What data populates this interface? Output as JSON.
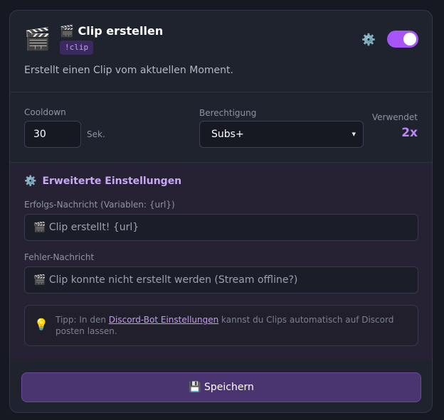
{
  "command": {
    "icon": "🎬",
    "icon_name": "clapperboard-icon",
    "title": "🎬 Clip erstellen",
    "trigger": "!clip",
    "description": "Erstellt einen Clip vom aktuellen Moment.",
    "enabled": true,
    "settings_icon": "⚙️"
  },
  "settings": {
    "cooldown_label": "Cooldown",
    "cooldown_value": "30",
    "cooldown_unit": "Sek.",
    "permission_label": "Berechtigung",
    "permission_value": "Subs+",
    "permission_chevron": "▾",
    "used_label": "Verwendet",
    "used_value": "2x"
  },
  "advanced": {
    "icon": "⚙️",
    "title": "Erweiterte Einstellungen",
    "success_label": "Erfolgs-Nachricht (Variablen: {url})",
    "success_placeholder": "🎬 Clip erstellt! {url}",
    "error_label": "Fehler-Nachricht",
    "error_placeholder": "🎬 Clip konnte nicht erstellt werden (Stream offline?)",
    "tip_icon": "💡",
    "tip_prefix": "Tipp: In den ",
    "tip_link": "Discord-Bot Einstellungen",
    "tip_suffix": " kannst du Clips automatisch auf Discord posten lassen."
  },
  "footer": {
    "save_label": "💾 Speichern"
  },
  "colors": {
    "accent": "#a855f7",
    "used_value": "#c084fc",
    "save_button": "#4a3570"
  }
}
